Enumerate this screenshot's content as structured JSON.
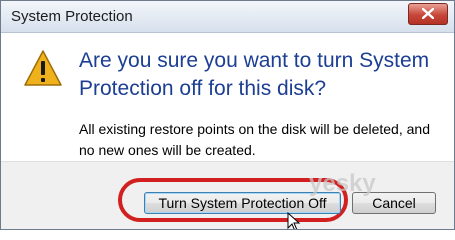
{
  "dialog": {
    "title": "System Protection",
    "question": "Are you sure you want to turn System Protection off for this disk?",
    "details": "All existing restore points on the disk will be deleted, and no new ones will be created.",
    "icon": "warning-icon"
  },
  "buttons": {
    "confirm_label": "Turn System Protection Off",
    "cancel_label": "Cancel"
  },
  "watermark": {
    "text": "yesky"
  },
  "colors": {
    "question_text": "#1c3f93",
    "highlight": "#d21f1f",
    "warning_fill": "#f0b21c"
  }
}
